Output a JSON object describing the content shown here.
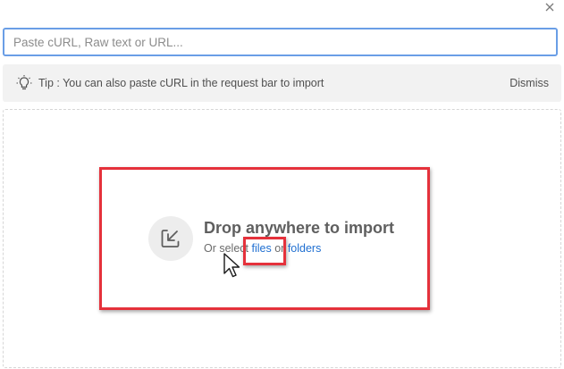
{
  "dialog": {
    "close_icon": "close-icon"
  },
  "input": {
    "placeholder": "Paste cURL, Raw text or URL...",
    "value": ""
  },
  "tip": {
    "icon": "lightbulb-icon",
    "text": "Tip : You can also paste cURL in the request bar to import",
    "dismiss_label": "Dismiss"
  },
  "dropzone": {
    "icon": "import-download-icon",
    "title": "Drop anywhere to import",
    "subtitle_prefix": "Or select",
    "files_link": "files",
    "or_text": "or",
    "folders_link": "folders"
  },
  "annotations": {
    "highlight_color": "#e5313b",
    "cursor_icon": "mouse-pointer-icon"
  },
  "colors": {
    "input_border": "#6a9ee6",
    "link": "#1f6fd1",
    "tip_bg": "#f2f2f2"
  }
}
